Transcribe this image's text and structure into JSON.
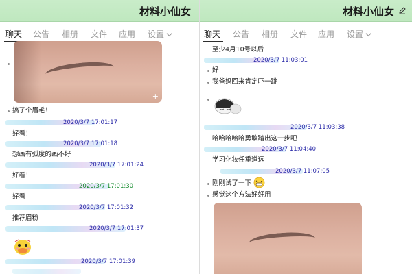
{
  "left": {
    "title": "材料小仙女",
    "tabs": [
      {
        "label": "聊天",
        "active": true
      },
      {
        "label": "公告"
      },
      {
        "label": "相册"
      },
      {
        "label": "文件"
      },
      {
        "label": "应用"
      },
      {
        "label": "设置"
      }
    ],
    "messages": [
      {
        "text": "搞了个眉毛！",
        "time": "2020/3/7 17:01:17"
      },
      {
        "text": "好看！",
        "time": "2020/3/7 17:01:18"
      },
      {
        "text": "想画有弧度的画不好",
        "time": "2020/3/7 17:01:24"
      },
      {
        "text": "好看！",
        "time": "2020/3/7 17:01:30"
      },
      {
        "text": "好看",
        "time": "2020/3/7 17:01:32"
      },
      {
        "text": "推荐眉粉",
        "time": "2020/3/7 17:01:37"
      },
      {
        "text": "",
        "time": "2020/3/7 17:01:39"
      }
    ]
  },
  "right": {
    "title": "材料小仙女",
    "tabs": [
      {
        "label": "聊天",
        "active": true
      },
      {
        "label": "公告"
      },
      {
        "label": "相册"
      },
      {
        "label": "文件"
      },
      {
        "label": "应用"
      },
      {
        "label": "设置"
      }
    ],
    "messages": [
      {
        "text": "至少4月10号以后",
        "time": "2020/3/7 11:03:01"
      },
      {
        "text": "好"
      },
      {
        "text": "我爸妈回来肯定吓一跳"
      },
      {
        "text": "",
        "time": "2020/3/7 11:03:38"
      },
      {
        "text": "哈哈哈哈哈勇敢踏出这一步吧",
        "time": "2020/3/7 11:04:40"
      },
      {
        "text": "学习化妆任重道远",
        "time": "2020/3/7 11:07:05"
      },
      {
        "text": "刚刚试了一下"
      },
      {
        "text": "感觉这个方法好好用"
      }
    ]
  },
  "colors": {
    "titlebar": "#c4eac4",
    "timestamp": "#2a2aa8",
    "timestamp_green": "#118a2a"
  }
}
